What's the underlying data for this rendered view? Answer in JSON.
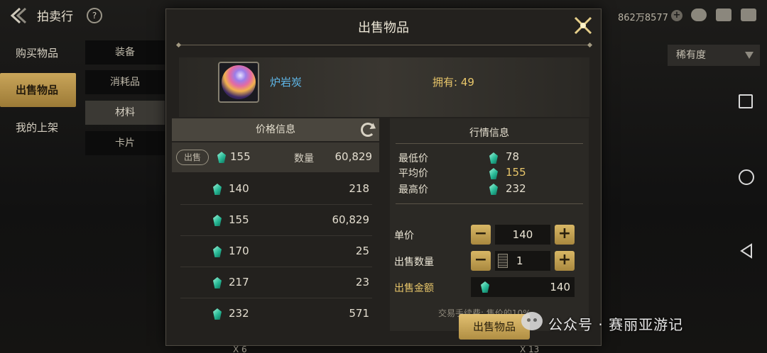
{
  "header": {
    "title": "拍卖行",
    "help_glyph": "?",
    "currency": "862万8577",
    "currency_add": "+"
  },
  "left_nav": [
    {
      "label": "购买物品",
      "active": false
    },
    {
      "label": "出售物品",
      "active": true
    },
    {
      "label": "我的上架",
      "active": false
    }
  ],
  "sub_nav": [
    {
      "label": "装备",
      "active": false
    },
    {
      "label": "消耗品",
      "active": false
    },
    {
      "label": "材料",
      "active": true
    },
    {
      "label": "卡片",
      "active": false
    }
  ],
  "filter": {
    "rarity_label": "稀有度"
  },
  "dialog": {
    "title": "出售物品",
    "item": {
      "name": "炉岩炭",
      "owned_text": "拥有: 49"
    },
    "price_panel": {
      "title": "价格信息",
      "first": {
        "tag": "出售",
        "price": "155",
        "qty_label": "数量",
        "qty": "60,829"
      },
      "rows": [
        {
          "price": "140",
          "qty": "218"
        },
        {
          "price": "155",
          "qty": "60,829"
        },
        {
          "price": "170",
          "qty": "25"
        },
        {
          "price": "217",
          "qty": "23"
        },
        {
          "price": "232",
          "qty": "571"
        }
      ]
    },
    "market": {
      "title": "行情信息",
      "min_label": "最低价",
      "min": "78",
      "avg_label": "平均价",
      "avg": "155",
      "max_label": "最高价",
      "max": "232"
    },
    "form": {
      "unit_price_label": "单价",
      "unit_price": "140",
      "quantity_label": "出售数量",
      "quantity": "1",
      "total_label": "出售金额",
      "total": "140",
      "minus": "−",
      "plus": "+"
    },
    "fee_note": "交易手续费: 售价的10%",
    "sell_button": "出售物品"
  },
  "background_bottom": {
    "left": "X 6",
    "right": "X 13"
  },
  "watermark": "公众号 · 赛丽亚游记",
  "colors": {
    "accent_gold": "#e8c66a",
    "item_name_blue": "#5fb7e8",
    "gem_green": "#27b996"
  }
}
